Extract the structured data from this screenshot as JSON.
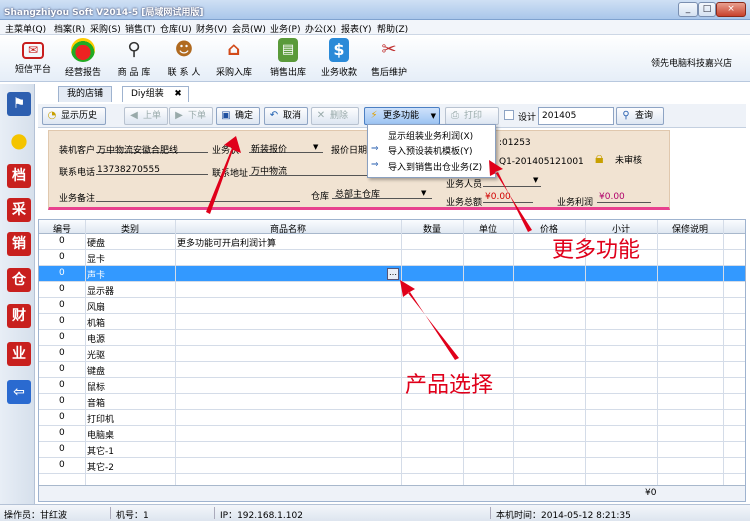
{
  "window": {
    "title": "Shangzhiyou Soft V2014-5 [局域网试用版]",
    "min": "_",
    "max": "□",
    "close": "×"
  },
  "menu": [
    "主菜单(Q)",
    "档案(R)",
    "采购(S)",
    "销售(T)",
    "仓库(U)",
    "财务(V)",
    "会员(W)",
    "业务(P)",
    "办公(X)",
    "报表(Y)",
    "帮助(Z)"
  ],
  "toolbar": {
    "items": [
      {
        "label": "短信平台",
        "icon": "envelope-icon"
      },
      {
        "label": "经营报告",
        "icon": "pie-chart-icon"
      },
      {
        "label": "商 品 库",
        "icon": "magnifier-icon"
      },
      {
        "label": "联 系 人",
        "icon": "person-icon"
      },
      {
        "label": "采购入库",
        "icon": "house-icon"
      },
      {
        "label": "销售出库",
        "icon": "document-icon"
      },
      {
        "label": "业务收款",
        "icon": "dollar-icon"
      },
      {
        "label": "售后维护",
        "icon": "tools-icon"
      }
    ],
    "company": "领先电脑科技嘉兴店"
  },
  "sidebar": [
    {
      "icon": "flag-icon",
      "glyph": "⚑"
    },
    {
      "icon": "bulb-icon",
      "glyph": "●"
    },
    {
      "icon": "stamp-dang-icon",
      "glyph": "档"
    },
    {
      "icon": "stamp-cai-icon",
      "glyph": "采"
    },
    {
      "icon": "stamp-xiao-icon",
      "glyph": "销"
    },
    {
      "icon": "stamp-cang-icon",
      "glyph": "仓"
    },
    {
      "icon": "stamp-cai2-icon",
      "glyph": "财"
    },
    {
      "icon": "stamp-ye-icon",
      "glyph": "业"
    },
    {
      "icon": "exit-icon",
      "glyph": "⇦"
    }
  ],
  "tabs": {
    "store": "我的店铺",
    "diy": "Diy组装",
    "close": "✖"
  },
  "actions": {
    "history": "显示历史",
    "prev": "上单",
    "next": "下单",
    "confirm": "确定",
    "cancel": "取消",
    "delete": "删除",
    "more": "更多功能",
    "print": "打印",
    "design": "设计",
    "period": "201405",
    "query": "查询"
  },
  "popup": [
    "显示组装业务利润(X)",
    "导入预设装机模板(Y)",
    "导入到销售出仓业务(Z)"
  ],
  "form": {
    "customer_label": "装机客户",
    "customer": "万中物流安徽合肥线",
    "status_label": "业务状",
    "status": "新装报价",
    "quote_date_label": "报价日期",
    "no_fragment": ":01253",
    "bill_fragment": "Q1-201405121001",
    "phone_label": "联系电话",
    "phone": "13738270555",
    "addr_label": "联系地址",
    "addr": "万中物流",
    "staff_fragment": "业务人员",
    "audit": "未审核",
    "remark_label": "业务备注",
    "warehouse_label": "仓库",
    "warehouse": "总部主仓库",
    "total_label": "业务总额",
    "total": "¥0.00",
    "profit_label": "业务利润",
    "profit": "¥0.00"
  },
  "grid": {
    "headers": [
      "编号",
      "类别",
      "商品名称",
      "数量",
      "单位",
      "价格",
      "小计",
      "保修说明"
    ],
    "rows": [
      {
        "no": "0",
        "cat": "硬盘",
        "name": "更多功能可开启利润计算"
      },
      {
        "no": "0",
        "cat": "显卡",
        "name": ""
      },
      {
        "no": "0",
        "cat": "声卡",
        "name": ""
      },
      {
        "no": "0",
        "cat": "显示器",
        "name": ""
      },
      {
        "no": "0",
        "cat": "风扇",
        "name": ""
      },
      {
        "no": "0",
        "cat": "机箱",
        "name": ""
      },
      {
        "no": "0",
        "cat": "电源",
        "name": ""
      },
      {
        "no": "0",
        "cat": "光驱",
        "name": ""
      },
      {
        "no": "0",
        "cat": "键盘",
        "name": ""
      },
      {
        "no": "0",
        "cat": "鼠标",
        "name": ""
      },
      {
        "no": "0",
        "cat": "音箱",
        "name": ""
      },
      {
        "no": "0",
        "cat": "打印机",
        "name": ""
      },
      {
        "no": "0",
        "cat": "电脑桌",
        "name": ""
      },
      {
        "no": "0",
        "cat": "其它-1",
        "name": ""
      },
      {
        "no": "0",
        "cat": "其它-2",
        "name": ""
      }
    ],
    "selected_row": 2,
    "picker": "…",
    "sum": "¥0"
  },
  "status": {
    "operator": "操作员：甘红波",
    "machine": "机号：1",
    "ip": "IP：192.168.1.102",
    "time": "本机时间：2014-05-12 8:21:35"
  },
  "annotations": {
    "more": "更多功能",
    "product": "产品选择"
  },
  "colors": {
    "accent": "#3399ff",
    "annotation": "#e0001a",
    "form_bg": "#f1e3d2",
    "form_border": "#e8418e"
  }
}
